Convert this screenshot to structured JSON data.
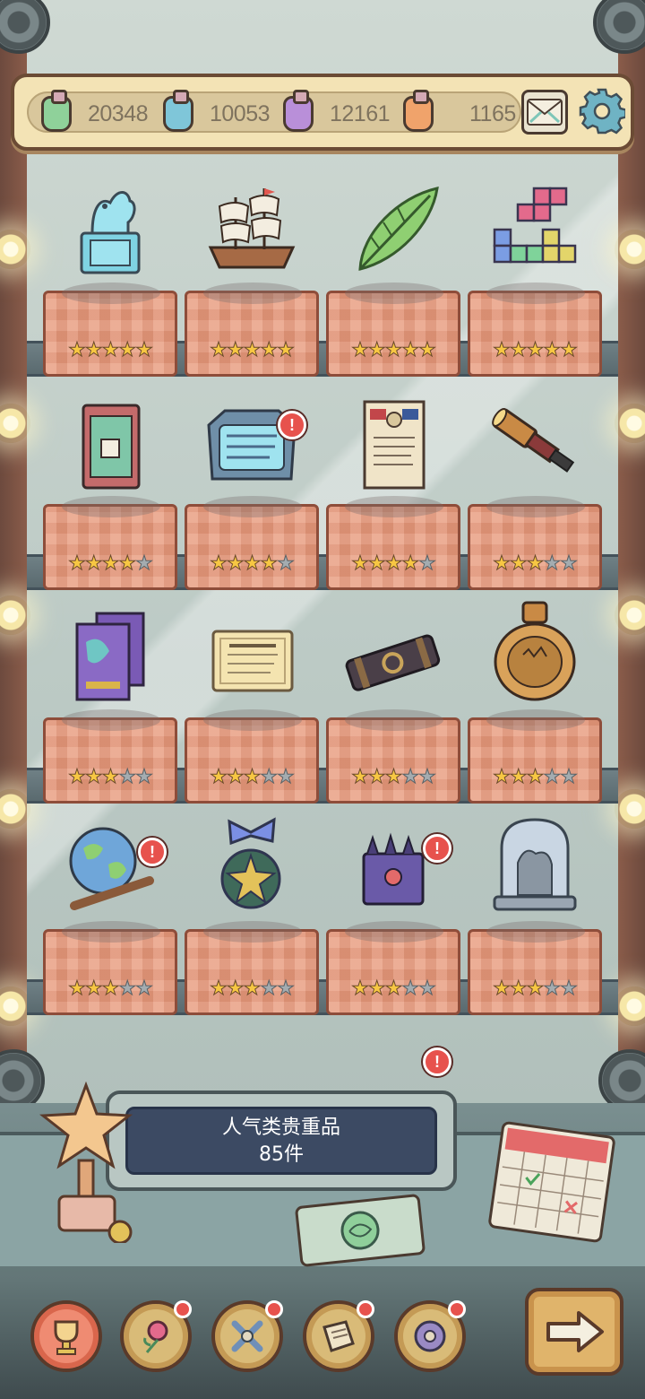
{
  "currencies": [
    {
      "icon": "green-potion-bottle-icon",
      "value": "20348",
      "color": "#8fd19a"
    },
    {
      "icon": "blue-potion-bottle-icon",
      "value": "10053",
      "color": "#7fc6d9"
    },
    {
      "icon": "purple-potion-bottle-icon",
      "value": "12161",
      "color": "#b98fd9"
    },
    {
      "icon": "orange-potion-bottle-icon",
      "value": "1165",
      "color": "#f0a36b"
    }
  ],
  "header": {
    "mail_icon": "mail-icon",
    "settings_icon": "gear-icon"
  },
  "collection": {
    "shelves": [
      {
        "items": [
          {
            "name": "jade-dragon-statue",
            "stars": 5,
            "alert": false
          },
          {
            "name": "sailing-ship-model",
            "stars": 5,
            "alert": false
          },
          {
            "name": "green-feather-quill",
            "stars": 5,
            "alert": false
          },
          {
            "name": "block-puzzle",
            "stars": 5,
            "alert": false
          }
        ]
      },
      {
        "items": [
          {
            "name": "ancient-book-box",
            "stars": 4,
            "alert": false
          },
          {
            "name": "inscribed-stone-tablet",
            "stars": 4,
            "alert": true
          },
          {
            "name": "declaration-document",
            "stars": 4,
            "alert": false
          },
          {
            "name": "brass-telescope",
            "stars": 3,
            "alert": false
          }
        ]
      },
      {
        "items": [
          {
            "name": "stacked-books",
            "stars": 3,
            "alert": false
          },
          {
            "name": "cairo-declaration-card",
            "stars": 3,
            "alert": false
          },
          {
            "name": "bound-scroll-case",
            "stars": 3,
            "alert": false
          },
          {
            "name": "bronze-vase",
            "stars": 3,
            "alert": false
          }
        ]
      },
      {
        "items": [
          {
            "name": "globe-on-stand",
            "stars": 3,
            "alert": true
          },
          {
            "name": "medal-with-ribbon",
            "stars": 3,
            "alert": false
          },
          {
            "name": "dark-spiked-chest",
            "stars": 3,
            "alert": true
          },
          {
            "name": "glass-dome-statue",
            "stars": 3,
            "alert": false
          }
        ]
      }
    ]
  },
  "plaque": {
    "title": "人气类贵重品",
    "count": "85件"
  },
  "desk": {
    "trophy_icon": "star-trophy-icon",
    "calendar_icon": "calendar-icon",
    "map_icon": "map-scroll-icon",
    "alert_icon": "alert-badge-icon"
  },
  "bottom_nav": [
    {
      "icon": "trophy-cup-icon",
      "active": true,
      "dot": false
    },
    {
      "icon": "rose-icon",
      "active": false,
      "dot": true
    },
    {
      "icon": "crossed-tools-icon",
      "active": false,
      "dot": true
    },
    {
      "icon": "scroll-map-icon",
      "active": false,
      "dot": true
    },
    {
      "icon": "gear-icon",
      "active": false,
      "dot": true
    }
  ],
  "next_button": {
    "icon": "arrow-right-icon"
  },
  "alert_text": "!",
  "colors": {
    "star_on": "#f7c743",
    "star_off": "#a4acb0",
    "plate": "#e8987a",
    "alert": "#e7524d"
  }
}
